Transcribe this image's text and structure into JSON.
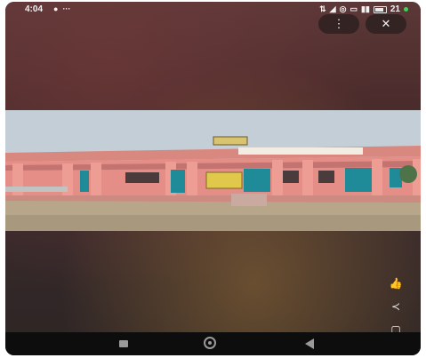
{
  "status_bar": {
    "time": "4:04",
    "left_icons": [
      "chat-icon",
      "more-dots-icon"
    ],
    "right_icons": [
      "data-icon",
      "location-icon",
      "hotspot-icon",
      "volte-icon",
      "signal-icon"
    ],
    "battery_text": "21"
  },
  "viewer": {
    "menu_icon": "⋮",
    "close_icon": "✕",
    "photo": {
      "sign_text": "",
      "banner_text": ""
    },
    "side_actions": [
      {
        "name": "like-icon",
        "glyph": "👍"
      },
      {
        "name": "share-icon",
        "glyph": "≺"
      },
      {
        "name": "info-icon",
        "glyph": "▢"
      }
    ]
  },
  "nav_bar": {
    "items": [
      "recents",
      "home",
      "back"
    ]
  },
  "colors": {
    "wall": "#e08a84",
    "door": "#1f8c9a",
    "sky": "#c2ccd4",
    "ground": "#b9a88c"
  }
}
